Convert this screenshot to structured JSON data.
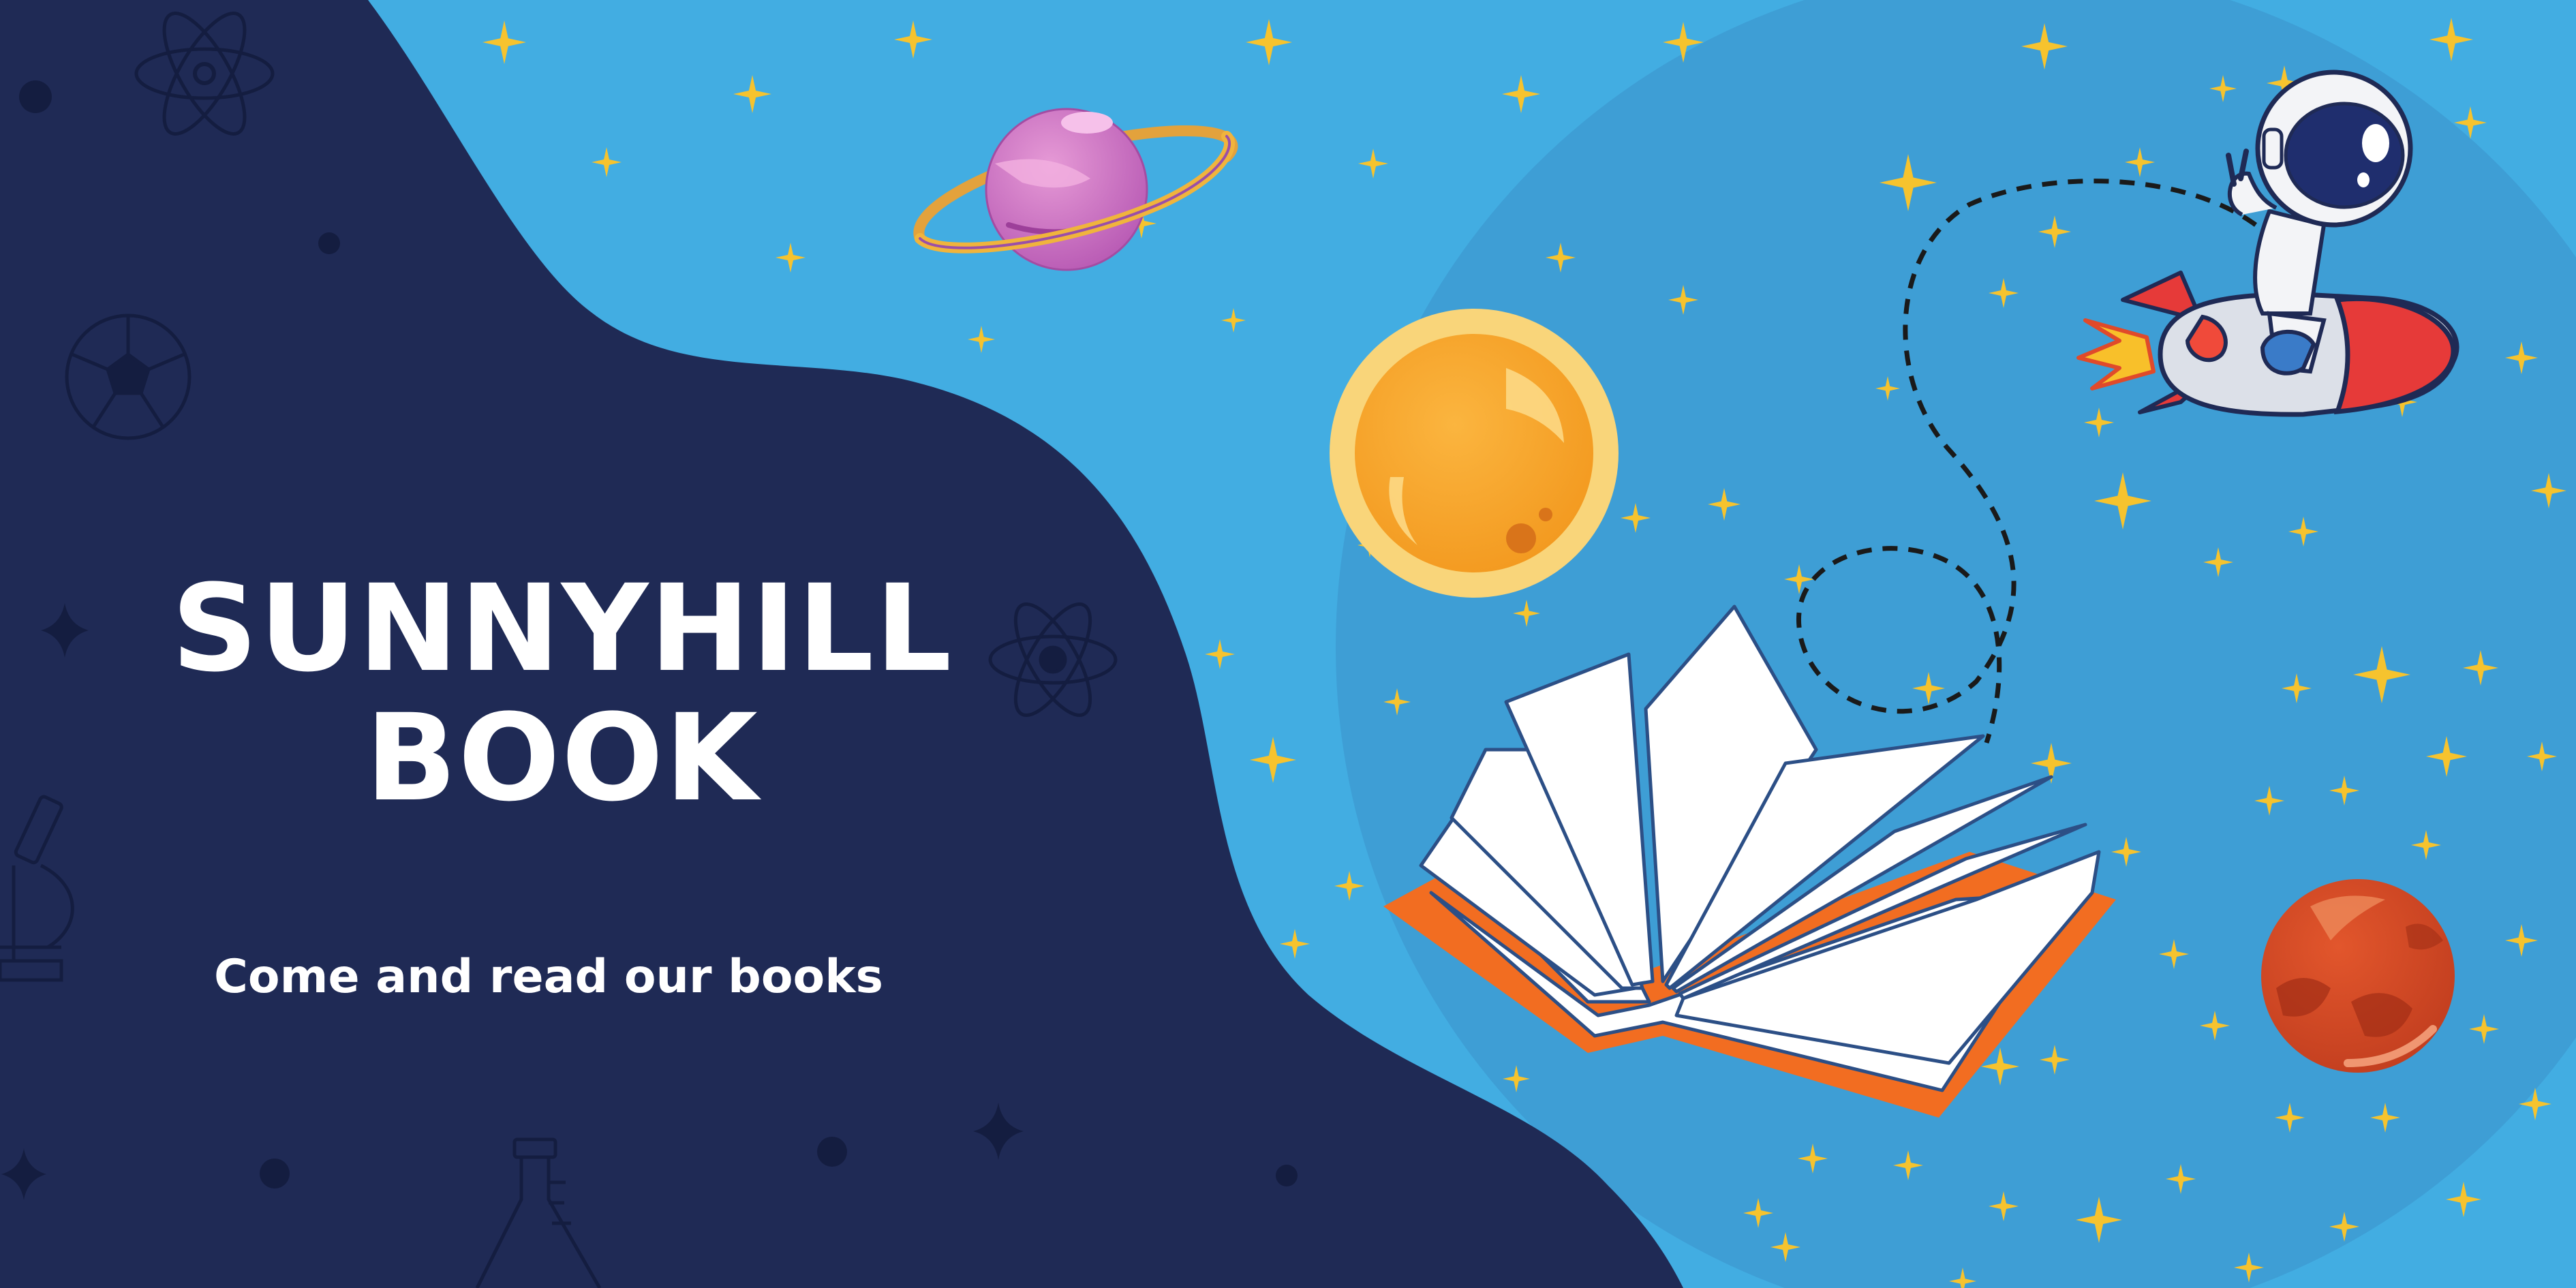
{
  "banner": {
    "title_line1": "SUNNYHILL",
    "title_line2": "BOOK",
    "tagline": "Come and read our books"
  },
  "colors": {
    "sky": "#42ADE2",
    "navy": "#1F2A55",
    "circle": "#3E9ED5",
    "star": "#F6C32E",
    "book_cover": "#F26D21",
    "text": "#FFFFFF"
  },
  "icons": [
    "atom-icon",
    "soccer-ball-icon",
    "microscope-icon",
    "flask-icon",
    "sparkle-icon",
    "ringed-planet-icon",
    "sun-icon",
    "open-book-icon",
    "astronaut-on-rocket-icon",
    "mars-planet-icon",
    "star-icon",
    "dashed-trail-icon"
  ]
}
